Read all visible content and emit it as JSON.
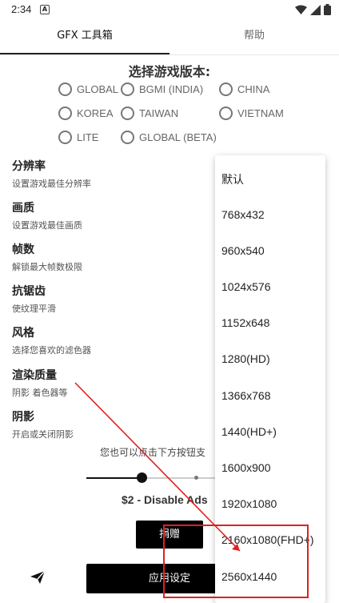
{
  "status_bar": {
    "time": "2:34",
    "notif_glyph": "A"
  },
  "tabs": [
    {
      "label": "GFX 工具箱"
    },
    {
      "label": "帮助"
    }
  ],
  "version": {
    "title": "选择游戏版本:",
    "options": [
      "GLOBAL",
      "BGMI (INDIA)",
      "CHINA",
      "KOREA",
      "TAIWAN",
      "VIETNAM",
      "LITE",
      "GLOBAL (BETA)"
    ]
  },
  "settings": [
    {
      "title": "分辨率",
      "subtitle": "设置游戏最佳分辨率"
    },
    {
      "title": "画质",
      "subtitle": "设置游戏最佳画质"
    },
    {
      "title": "帧数",
      "subtitle": "解锁最大帧数极限"
    },
    {
      "title": "抗锯齿",
      "subtitle": "使纹理平滑"
    },
    {
      "title": "风格",
      "subtitle": "选择您喜欢的滤色器"
    },
    {
      "title": "渲染质量",
      "subtitle": "阴影 着色器等"
    },
    {
      "title": "阴影",
      "subtitle": "开启或关闭阴影"
    }
  ],
  "hint": "您也可以点击下方按钮支",
  "ads_label": "$2 - Disable Ads",
  "donate_label": "捐赠",
  "apply_label": "应用设定",
  "resolution_dropdown": {
    "items": [
      "默认",
      "768x432",
      "960x540",
      "1024x576",
      "1152x648",
      "1280(HD)",
      "1366x768",
      "1440(HD+)",
      "1600x900",
      "1920x1080",
      "2160x1080(FHD+)",
      "2560x1440"
    ]
  },
  "annotation_color": "#e02020",
  "icons": [
    "wifi-icon",
    "signal-icon",
    "battery-icon",
    "send-icon"
  ]
}
